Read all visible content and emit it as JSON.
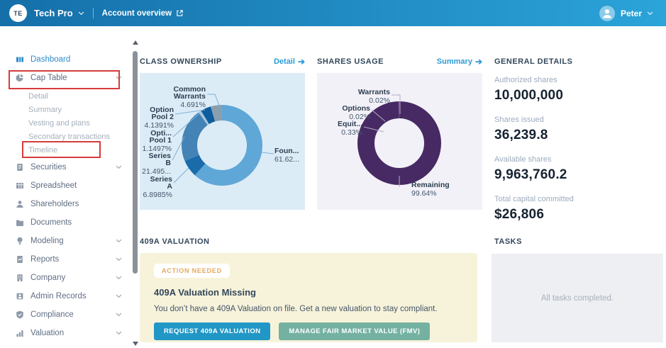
{
  "header": {
    "org_initials": "TE",
    "org_name": "Tech Pro",
    "account_overview_label": "Account overview",
    "user_name": "Peter"
  },
  "icons": {
    "arrow_right": "➔"
  },
  "colors": {
    "header_gradient_start": "#156fa9",
    "header_gradient_end": "#2ba4d9",
    "link_blue": "#2e9bd8",
    "active_nav_blue": "#2f8cc9",
    "badge_orange": "#e4a860",
    "primary_button_bg": "#2197c6",
    "secondary_button_bg": "#74b1a1",
    "annotation_red": "#d63b3b",
    "class_card_bg": "#dcecf7",
    "shares_card_bg": "#f3f1f8",
    "valuation_card_bg": "#f7f3da",
    "tasks_card_bg": "#edeff2"
  },
  "sidebar": {
    "items": [
      {
        "label": "Dashboard",
        "icon": "dashboard-icon",
        "type": "primary",
        "active": true,
        "chevron": false
      },
      {
        "label": "Cap Table",
        "icon": "cap-table-icon",
        "type": "primary",
        "active": false,
        "chevron": true
      },
      {
        "label": "Detail",
        "type": "sub",
        "chevron": false
      },
      {
        "label": "Summary",
        "type": "sub",
        "chevron": false
      },
      {
        "label": "Vesting and plans",
        "type": "sub",
        "chevron": false
      },
      {
        "label": "Secondary transactions",
        "type": "sub",
        "chevron": false
      },
      {
        "label": "Timeline",
        "type": "sub",
        "chevron": false
      },
      {
        "label": "Securities",
        "icon": "securities-icon",
        "type": "primary",
        "active": false,
        "chevron": true
      },
      {
        "label": "Spreadsheet",
        "icon": "spreadsheet-icon",
        "type": "primary",
        "active": false,
        "chevron": false
      },
      {
        "label": "Shareholders",
        "icon": "shareholders-icon",
        "type": "primary",
        "active": false,
        "chevron": false
      },
      {
        "label": "Documents",
        "icon": "documents-icon",
        "type": "primary",
        "active": false,
        "chevron": false
      },
      {
        "label": "Modeling",
        "icon": "modeling-icon",
        "type": "primary",
        "active": false,
        "chevron": true
      },
      {
        "label": "Reports",
        "icon": "reports-icon",
        "type": "primary",
        "active": false,
        "chevron": true
      },
      {
        "label": "Company",
        "icon": "company-icon",
        "type": "primary",
        "active": false,
        "chevron": true
      },
      {
        "label": "Admin Records",
        "icon": "admin-records-icon",
        "type": "primary",
        "active": false,
        "chevron": true
      },
      {
        "label": "Compliance",
        "icon": "compliance-icon",
        "type": "primary",
        "active": false,
        "chevron": true
      },
      {
        "label": "Valuation",
        "icon": "valuation-icon",
        "type": "primary",
        "active": false,
        "chevron": true
      }
    ]
  },
  "sections": {
    "class_ownership": {
      "title": "CLASS OWNERSHIP",
      "link": "Detail"
    },
    "shares_usage": {
      "title": "SHARES USAGE",
      "link": "Summary"
    },
    "general_details": {
      "title": "GENERAL DETAILS",
      "stats": [
        {
          "label": "Authorized shares",
          "value": "10,000,000"
        },
        {
          "label": "Shares issued",
          "value": "36,239.8"
        },
        {
          "label": "Available shares",
          "value": "9,963,760.2"
        },
        {
          "label": "Total capital committed",
          "value": "$26,806"
        }
      ]
    },
    "valuation_409a": {
      "title": "409A VALUATION",
      "badge": "ACTION NEEDED",
      "heading": "409A Valuation Missing",
      "body": "You don’t have a 409A Valuation on file. Get a new valuation to stay compliant.",
      "primary_button": "REQUEST 409A VALUATION",
      "secondary_button": "MANAGE FAIR MARKET VALUE (FMV)"
    },
    "tasks": {
      "title": "TASKS",
      "empty_message": "All tasks completed."
    }
  },
  "chart_data": [
    {
      "type": "pie",
      "title": "CLASS OWNERSHIP",
      "units": "percent",
      "legend_position": "callout-labels",
      "segments": [
        {
          "label_lines": [
            "Foun..."
          ],
          "value_label": "61.62...",
          "value": 61.6227,
          "color": "#5fa7d7"
        },
        {
          "label_lines": [
            "Series",
            "A"
          ],
          "value_label": "6.8985%",
          "value": 6.8985,
          "color": "#1a6baa"
        },
        {
          "label_lines": [
            "Series",
            "B"
          ],
          "value_label": "21.495...",
          "value": 21.495,
          "color": "#4383b5"
        },
        {
          "label_lines": [
            "Opti...",
            "Pool 1"
          ],
          "value_label": "1.1497%",
          "value": 1.1497,
          "color": "#a3c7e0"
        },
        {
          "label_lines": [
            "Option",
            "Pool 2"
          ],
          "value_label": "4.1391%",
          "value": 4.1391,
          "color": "#0e5d9d"
        },
        {
          "label_lines": [
            "Common",
            "Warrants"
          ],
          "value_label": "4.691%",
          "value": 4.691,
          "color": "#8ba0af"
        }
      ]
    },
    {
      "type": "pie",
      "title": "SHARES USAGE",
      "units": "percent",
      "legend_position": "callout-labels",
      "segments": [
        {
          "label_lines": [
            "Remaining"
          ],
          "value_label": "99.64%",
          "value": 99.64,
          "color": "#472a63"
        },
        {
          "label_lines": [
            "Equit..."
          ],
          "value_label": "0.33%",
          "value": 0.33,
          "color": "#8577a0"
        },
        {
          "label_lines": [
            "Options"
          ],
          "value_label": "0.02%",
          "value": 0.02,
          "color": "#a89dbd"
        },
        {
          "label_lines": [
            "Warrants"
          ],
          "value_label": "0.02%",
          "value": 0.02,
          "color": "#c3bad3"
        }
      ]
    }
  ]
}
